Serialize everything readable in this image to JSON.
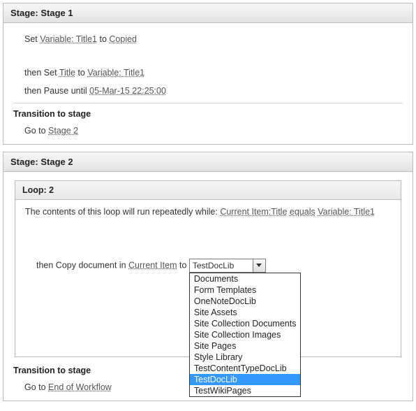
{
  "stage1": {
    "header": "Stage: Stage 1",
    "line1_before": "Set ",
    "line1_link1": "Variable: Title1",
    "line1_mid": " to ",
    "line1_link2": "Copied",
    "line2_before": "then Set ",
    "line2_link1": "Title",
    "line2_mid": " to ",
    "line2_link2": "Variable: Title1",
    "line3_before": "then Pause until ",
    "line3_link": "05-Mar-15 22:25:00",
    "transition_label": "Transition to stage",
    "goto_before": "Go to ",
    "goto_link": "Stage 2"
  },
  "stage2": {
    "header": "Stage: Stage 2",
    "loop": {
      "header": "Loop: 2",
      "cond_text": "The contents of this loop will run repeatedly while: ",
      "cond_link1": "Current Item:Title",
      "cond_mid": " ",
      "cond_link2": "equals",
      "cond_mid2": " ",
      "cond_link3": "Variable: Title1",
      "copy_before": "then Copy document in ",
      "copy_link": "Current Item",
      "copy_mid": " to ",
      "combo_value": "TestDocLib",
      "options": [
        "Documents",
        "Form Templates",
        "OneNoteDocLib",
        "Site Assets",
        "Site Collection Documents",
        "Site Collection Images",
        "Site Pages",
        "Style Library",
        "TestContentTypeDocLib",
        "TestDocLib",
        "TestWikiPages"
      ],
      "selected_option": "TestDocLib"
    },
    "transition_label": "Transition to stage",
    "goto_before": "Go to ",
    "goto_link": "End of Workflow"
  }
}
